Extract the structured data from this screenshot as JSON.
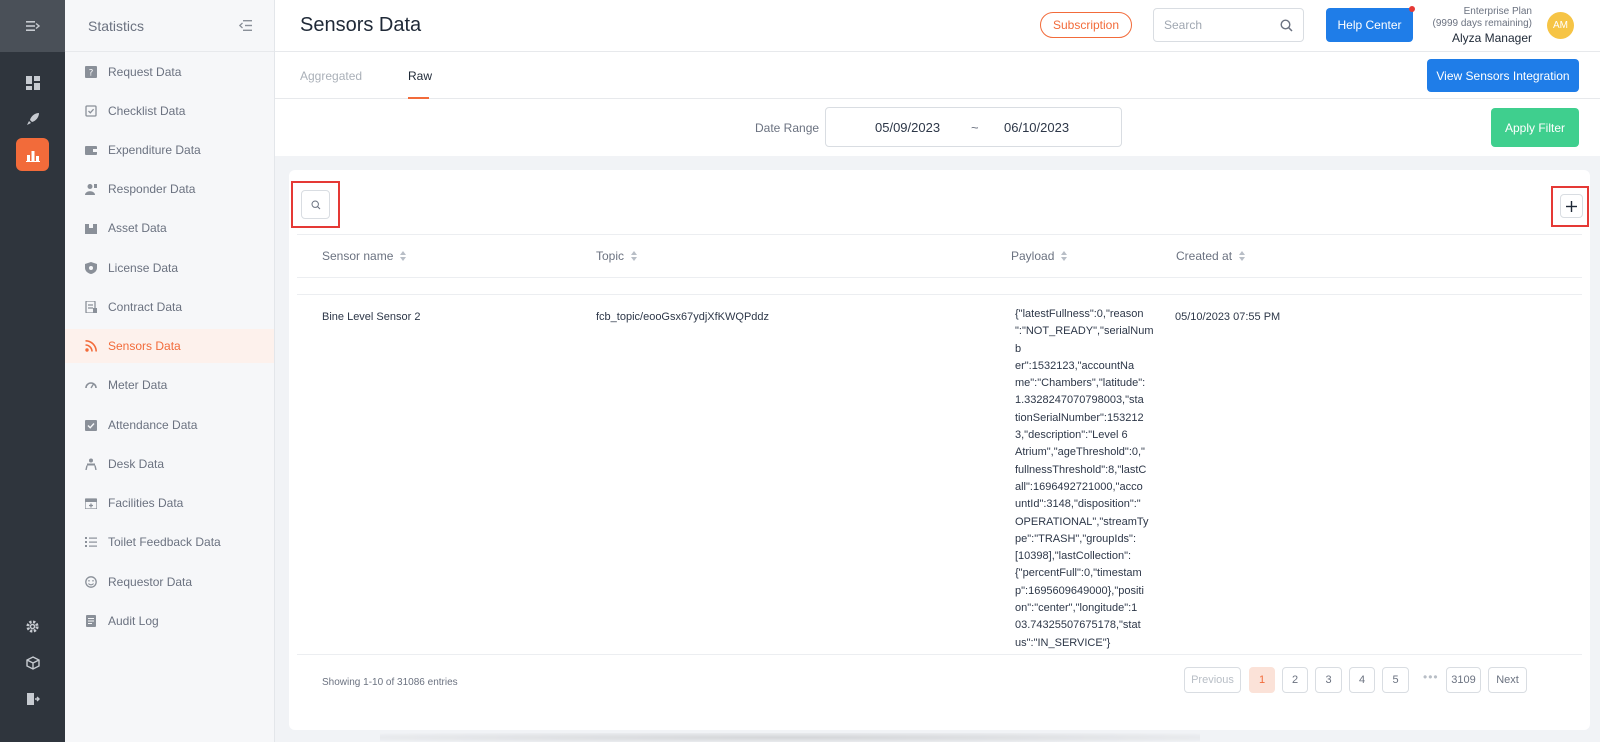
{
  "sidebar": {
    "title": "Statistics",
    "items": [
      {
        "label": "Request Data",
        "icon": "question-square-icon"
      },
      {
        "label": "Checklist Data",
        "icon": "checklist-icon"
      },
      {
        "label": "Expenditure Data",
        "icon": "wallet-icon"
      },
      {
        "label": "Responder Data",
        "icon": "responder-icon"
      },
      {
        "label": "Asset Data",
        "icon": "box-icon"
      },
      {
        "label": "License Data",
        "icon": "shield-icon"
      },
      {
        "label": "Contract Data",
        "icon": "contract-icon"
      },
      {
        "label": "Sensors Data",
        "icon": "rss-icon",
        "active": true
      },
      {
        "label": "Meter Data",
        "icon": "gauge-icon"
      },
      {
        "label": "Attendance Data",
        "icon": "attendance-icon"
      },
      {
        "label": "Desk Data",
        "icon": "desk-icon"
      },
      {
        "label": "Facilities Data",
        "icon": "calendar-icon"
      },
      {
        "label": "Toilet Feedback Data",
        "icon": "list-icon"
      },
      {
        "label": "Requestor Data",
        "icon": "smile-icon"
      },
      {
        "label": "Audit Log",
        "icon": "audit-icon"
      }
    ]
  },
  "header": {
    "title": "Sensors Data",
    "subscription_label": "Subscription",
    "search_placeholder": "Search",
    "help_label": "Help Center",
    "plan_name": "Enterprise Plan",
    "plan_days": "(9999 days remaining)",
    "user_name": "Alyza Manager",
    "avatar_initials": "AM"
  },
  "tabs": {
    "aggregated": "Aggregated",
    "raw": "Raw",
    "view_integration": "View Sensors Integration"
  },
  "filter": {
    "date_range_label": "Date Range",
    "start": "05/09/2023",
    "separator": "~",
    "end": "06/10/2023",
    "apply_label": "Apply Filter"
  },
  "table": {
    "columns": [
      "Sensor name",
      "Topic",
      "Payload",
      "Created at"
    ],
    "rows": [
      {
        "sensor_name": "Bine Level Sensor 2",
        "topic": "fcb_topic/eooGsx67ydjXfKWQPddz",
        "payload": "{\"latestFullness\":0,\"reason\":\"NOT_READY\",\"serialNumber\":1532123,\"accountName\":\"Chambers\",\"latitude\":1.3328247070798003,\"stationSerialNumber\":1532123,\"description\":\"Level 6 Atrium\",\"ageThreshold\":0,\"fullnessThreshold\":8,\"lastCall\":1696492721000,\"accountId\":3148,\"disposition\":\"OPERATIONAL\",\"streamType\":\"TRASH\",\"groupIds\":[10398],\"lastCollection\":{\"percentFull\":0,\"timestamp\":1695609649000},\"position\":\"center\",\"longitude\":103.74325507675178,\"status\":\"IN_SERVICE\"}",
        "payload_lines": [
          "{\"latestFullness\":0,\"reason",
          "\":\"NOT_READY\",\"serialNumb",
          "er\":1532123,\"accountNa",
          "me\":\"Chambers\",\"latitude\":",
          "1.3328247070798003,\"sta",
          "tionSerialNumber\":153212",
          "3,\"description\":\"Level 6",
          "Atrium\",\"ageThreshold\":0,\"",
          "fullnessThreshold\":8,\"lastC",
          "all\":1696492721000,\"acco",
          "untId\":3148,\"disposition\":\"",
          "OPERATIONAL\",\"streamTy",
          "pe\":\"TRASH\",\"groupIds\":",
          "[10398],\"lastCollection\":",
          "{\"percentFull\":0,\"timestam",
          "p\":1695609649000},\"positi",
          "on\":\"center\",\"longitude\":1",
          "03.74325507675178,\"stat",
          "us\":\"IN_SERVICE\"}"
        ],
        "created_at": "05/10/2023 07:55 PM"
      }
    ],
    "entries_text": "Showing 1-10 of 31086 entries"
  },
  "pagination": {
    "previous": "Previous",
    "pages": [
      "1",
      "2",
      "3",
      "4",
      "5"
    ],
    "ellipsis": "•••",
    "last": "3109",
    "next": "Next",
    "current": "1"
  },
  "colors": {
    "accent": "#f26b3a",
    "primary": "#1f7de8",
    "success": "#3fcf8e",
    "highlight": "#e53935"
  }
}
